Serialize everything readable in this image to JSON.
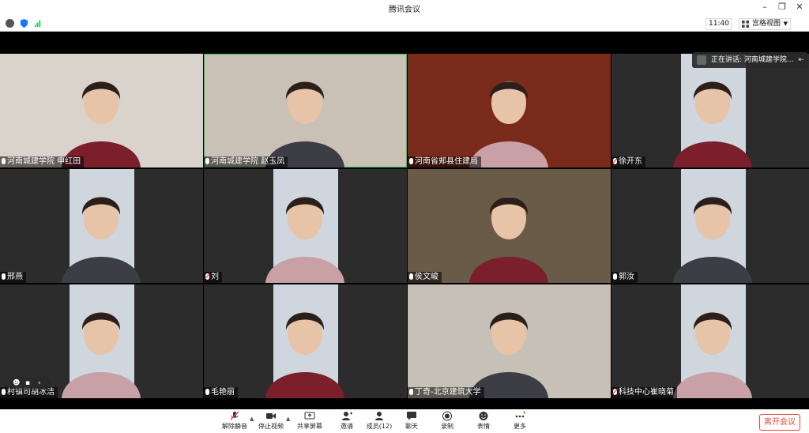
{
  "app": {
    "title": "腾讯会议"
  },
  "info": {
    "time": "11:40",
    "view_mode": "宫格视图"
  },
  "speaking": {
    "label": "正在讲话: 河南城建学院..."
  },
  "participants": [
    {
      "name": "河南城建学院 申红田",
      "mic": "on",
      "bg": "#d9d3cc",
      "active": false
    },
    {
      "name": "河南城建学院 赵玉凤",
      "mic": "on",
      "bg": "#c9c0b6",
      "active": true
    },
    {
      "name": "河南省郏县住建局",
      "mic": "on",
      "bg": "#7a2a1a",
      "active": false
    },
    {
      "name": "徐开东",
      "mic": "off",
      "bg": "#2c2c2c",
      "active": false
    },
    {
      "name": "邢燕",
      "mic": "on",
      "bg": "#2c2c2c",
      "active": false
    },
    {
      "name": "刘",
      "mic": "off",
      "bg": "#2c2c2c",
      "active": false
    },
    {
      "name": "侯文峻",
      "mic": "on",
      "bg": "#6a5a48",
      "active": false
    },
    {
      "name": "郭汝",
      "mic": "on",
      "bg": "#2c2c2c",
      "active": false
    },
    {
      "name": "村镇司胡冰洁",
      "mic": "on",
      "bg": "#2c2c2c",
      "active": false
    },
    {
      "name": "毛艳丽",
      "mic": "on",
      "bg": "#2c2c2c",
      "active": false
    },
    {
      "name": "丁奇-北京建筑大学",
      "mic": "on",
      "bg": "#c7c0b7",
      "active": false
    },
    {
      "name": "科技中心崔晓菊",
      "mic": "off",
      "bg": "#2c2c2c",
      "active": false
    }
  ],
  "toolbar": {
    "mute": "解除静音",
    "video": "停止视频",
    "share": "共享屏幕",
    "invite": "邀请",
    "members": "成员(12)",
    "chat": "聊天",
    "record": "录制",
    "reaction": "表情",
    "more": "更多",
    "leave": "离开会议"
  },
  "colors": {
    "accent": "#2fbf56",
    "leave": "#e14b3b",
    "stage": "#000000"
  }
}
